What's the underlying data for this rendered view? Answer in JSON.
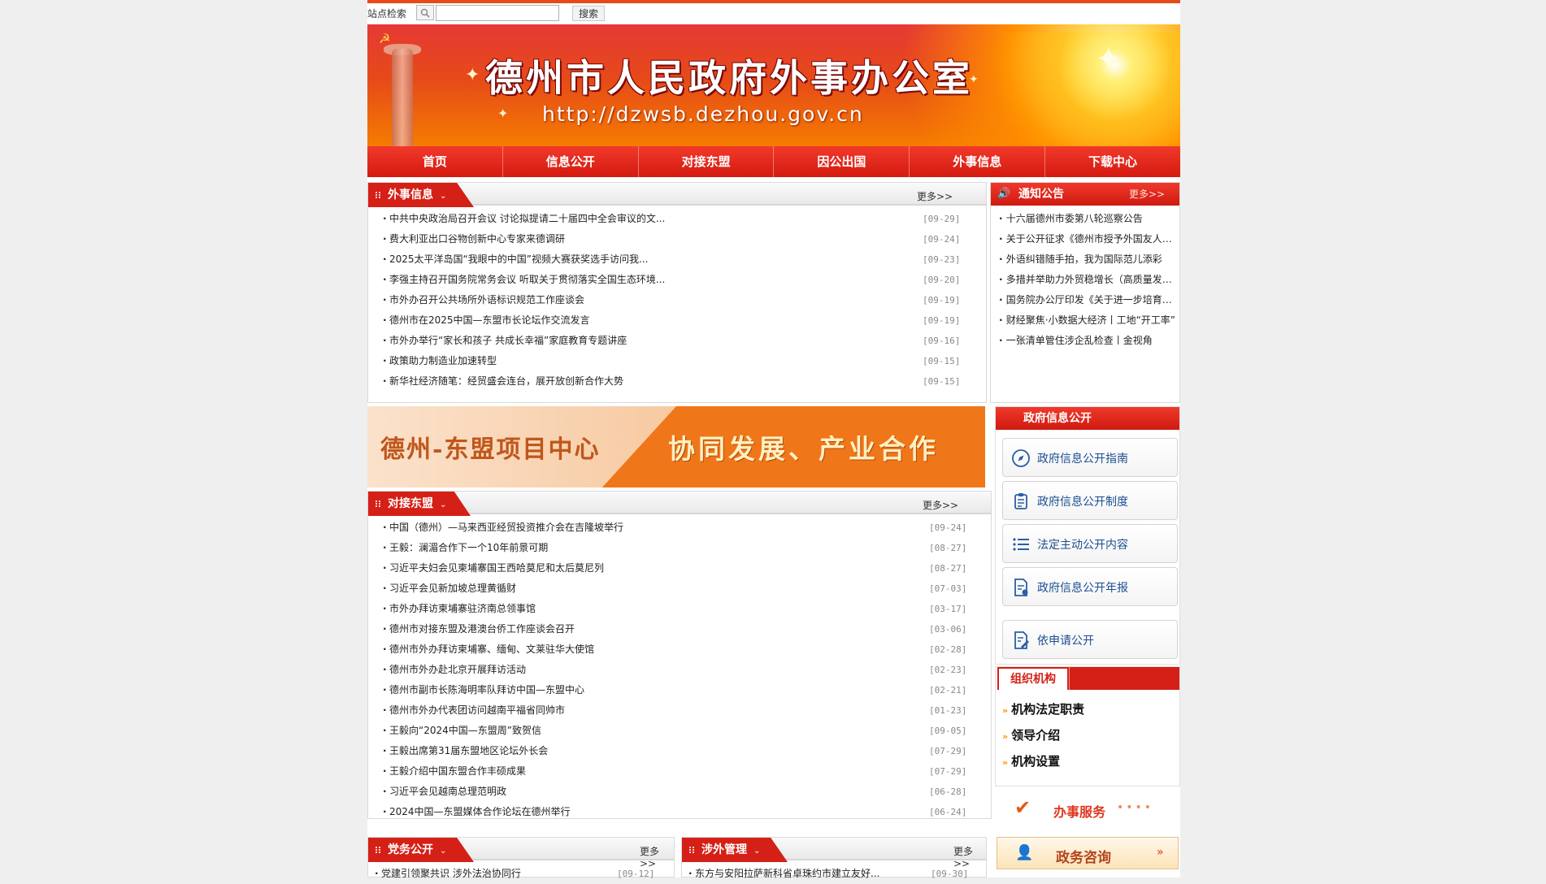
{
  "search": {
    "label": "站点检索",
    "placeholder": "",
    "button": "搜索"
  },
  "banner": {
    "title": "德州市人民政府外事办公室",
    "url": "http://dzwsb.dezhou.gov.cn"
  },
  "nav": [
    "首页",
    "信息公开",
    "对接东盟",
    "因公出国",
    "外事信息",
    "下载中心"
  ],
  "waishi": {
    "title": "外事信息",
    "more": "更多>>",
    "items": [
      {
        "t": "中共中央政治局召开会议 讨论拟提请二十届四中全会审议的文...",
        "d": "[09-29]"
      },
      {
        "t": "费大利亚出口谷物创新中心专家来德调研",
        "d": "[09-24]"
      },
      {
        "t": "2025太平洋岛国“我眼中的中国”视频大赛获奖选手访问我...",
        "d": "[09-23]"
      },
      {
        "t": "李强主持召开国务院常务会议 听取关于贯彻落实全国生态环境...",
        "d": "[09-20]"
      },
      {
        "t": "市外办召开公共场所外语标识规范工作座谈会",
        "d": "[09-19]"
      },
      {
        "t": "德州市在2025中国—东盟市长论坛作交流发言",
        "d": "[09-19]"
      },
      {
        "t": "市外办举行“家长和孩子 共成长幸福”家庭教育专题讲座",
        "d": "[09-16]"
      },
      {
        "t": "政策助力制造业加速转型",
        "d": "[09-15]"
      },
      {
        "t": "新华社经济随笔：经贸盛会连台，展开放创新合作大势",
        "d": "[09-15]"
      }
    ]
  },
  "notice": {
    "title": "通知公告",
    "more": "更多>>",
    "items": [
      "十六届德州市委第八轮巡察公告",
      "关于公开征求《德州市授予外国友人荣誉市民称号办法》意见",
      "外语纠错随手拍，我为国际范儿添彩",
      "多措并举助力外贸稳增长（高质量发展）",
      "国务院办公厅印发《关于进一步培育新增长点繁荣文化和旅游》",
      "财经聚焦·小数据大经济丨工地“开工率”",
      "一张清单管住涉企乱检查丨金视角"
    ]
  },
  "asean_banner": {
    "left": "德州-东盟项目中心",
    "right": "协同发展、产业合作"
  },
  "asean": {
    "title": "对接东盟",
    "more": "更多>>",
    "items": [
      {
        "t": "中国（德州）—马来西亚经贸投资推介会在吉隆坡举行",
        "d": "[09-24]"
      },
      {
        "t": "王毅：澜湄合作下一个10年前景可期",
        "d": "[08-27]"
      },
      {
        "t": "习近平夫妇会见柬埔寨国王西哈莫尼和太后莫尼列",
        "d": "[08-27]"
      },
      {
        "t": "习近平会见新加坡总理黄循财",
        "d": "[07-03]"
      },
      {
        "t": "市外办拜访柬埔寨驻济南总领事馆",
        "d": "[03-17]"
      },
      {
        "t": "德州市对接东盟及港澳台侨工作座谈会召开",
        "d": "[03-06]"
      },
      {
        "t": "德州市外办拜访柬埔寨、缅甸、文莱驻华大使馆",
        "d": "[02-28]"
      },
      {
        "t": "德州市外办赴北京开展拜访活动",
        "d": "[02-23]"
      },
      {
        "t": "德州市副市长陈海明率队拜访中国—东盟中心",
        "d": "[02-21]"
      },
      {
        "t": "德州市外办代表团访问越南平福省同帅市",
        "d": "[01-23]"
      },
      {
        "t": "王毅向“2024中国—东盟周”致贺信",
        "d": "[09-05]"
      },
      {
        "t": "王毅出席第31届东盟地区论坛外长会",
        "d": "[07-29]"
      },
      {
        "t": "王毅介绍中国东盟合作丰硕成果",
        "d": "[07-29]"
      },
      {
        "t": "习近平会见越南总理范明政",
        "d": "[06-28]"
      },
      {
        "t": "2024中国—东盟媒体合作论坛在德州举行",
        "d": "[06-24]"
      }
    ]
  },
  "gov": {
    "title": "政府信息公开",
    "buttons": [
      {
        "label": "政府信息公开指南",
        "icon": "compass-icon"
      },
      {
        "label": "政府信息公开制度",
        "icon": "clipboard-icon"
      },
      {
        "label": "法定主动公开内容",
        "icon": "list-icon"
      },
      {
        "label": "政府信息公开年报",
        "icon": "document-icon"
      },
      {
        "label": "依申请公开",
        "icon": "edit-document-icon"
      }
    ]
  },
  "org": {
    "title": "组织机构",
    "items": [
      "机构法定职责",
      "领导介绍",
      "机构设置"
    ]
  },
  "service": {
    "banshi": "办事服务",
    "zixun": "政务咨询"
  },
  "dangwu": {
    "title": "党务公开",
    "more": "更多>>",
    "items": [
      {
        "t": "党建引领聚共识 涉外法治协同行",
        "d": "[09-12]"
      }
    ]
  },
  "sheway": {
    "title": "涉外管理",
    "more": "更多>>",
    "items": [
      {
        "t": "东方与安阳拉萨新科省卓珠约市建立友好...",
        "d": "[09-30]"
      }
    ]
  },
  "colors": {
    "primary_red": "#d42016",
    "nav_red": "#e02a1d",
    "link_blue": "#1d4f91",
    "accent_orange": "#f0761a"
  }
}
